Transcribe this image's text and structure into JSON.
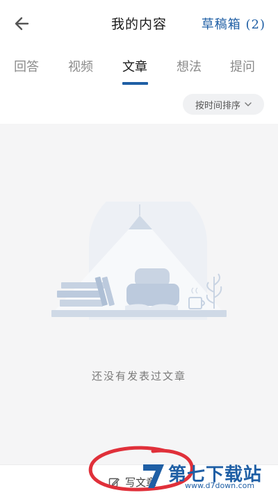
{
  "header": {
    "back_icon": "arrow-left-icon",
    "title": "我的内容",
    "drafts_label": "草稿箱 (2)"
  },
  "tabs": [
    {
      "label": "回答",
      "active": false
    },
    {
      "label": "视频",
      "active": false
    },
    {
      "label": "文章",
      "active": true
    },
    {
      "label": "想法",
      "active": false
    },
    {
      "label": "提问",
      "active": false
    }
  ],
  "sort": {
    "label": "按时间排序",
    "icon": "chevron-down-icon"
  },
  "empty": {
    "illustration": "empty-desk-illustration",
    "message": "还没有发表过文章"
  },
  "bottom": {
    "write_icon": "edit-icon",
    "write_label": "写文章"
  },
  "overlay": {
    "watermark_text": "第七下载站",
    "watermark_url": "www.d7down.com"
  },
  "colors": {
    "accent": "#1f5fa5",
    "background": "#f5f5f6",
    "annotation": "#e0303a"
  }
}
